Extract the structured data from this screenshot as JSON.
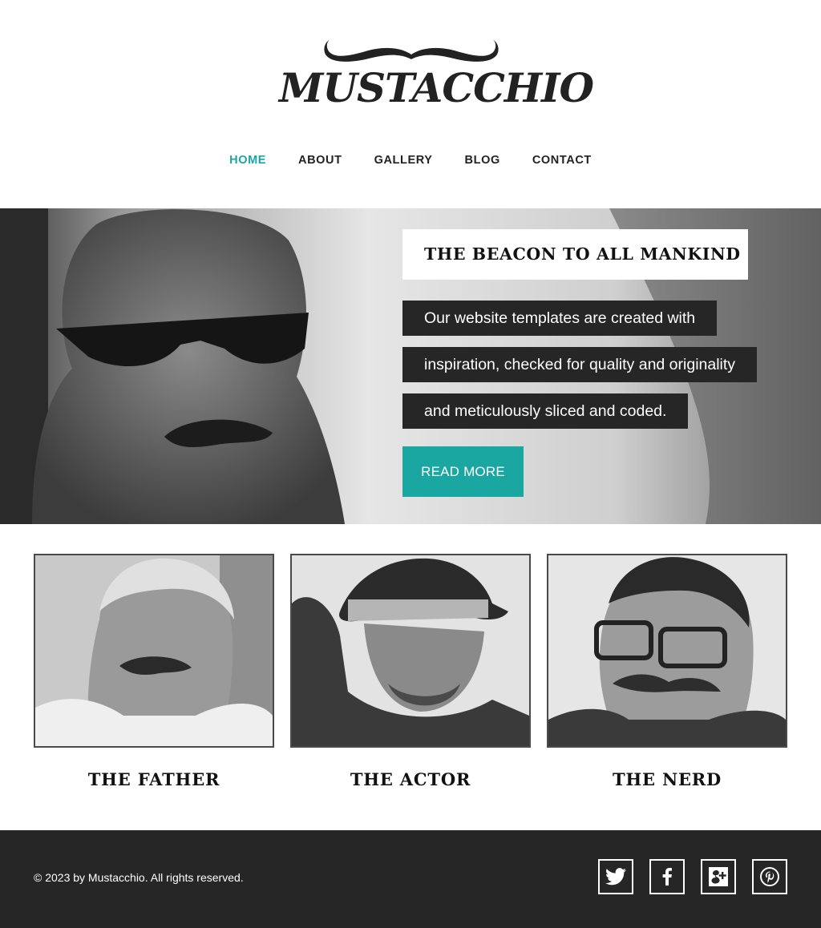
{
  "brand": {
    "name": "MUSTACCHIO"
  },
  "nav": {
    "items": [
      {
        "label": "HOME",
        "active": true
      },
      {
        "label": "ABOUT",
        "active": false
      },
      {
        "label": "GALLERY",
        "active": false
      },
      {
        "label": "BLOG",
        "active": false
      },
      {
        "label": "CONTACT",
        "active": false
      }
    ]
  },
  "hero": {
    "title": "THE BEACON TO ALL MANKIND",
    "lines": [
      "Our website templates are created with",
      "inspiration, checked for quality and originality",
      "and meticulously sliced and coded."
    ],
    "button_label": "READ MORE"
  },
  "cards": [
    {
      "title": "THE FATHER"
    },
    {
      "title": "THE ACTOR"
    },
    {
      "title": "THE NERD"
    }
  ],
  "footer": {
    "copyright": "© 2023 by Mustacchio. All rights reserved.",
    "social": [
      "twitter-icon",
      "facebook-icon",
      "google-plus-icon",
      "pinterest-icon"
    ]
  },
  "colors": {
    "accent": "#1aa6a1",
    "dark": "#262626",
    "text": "#222222",
    "white": "#ffffff"
  }
}
